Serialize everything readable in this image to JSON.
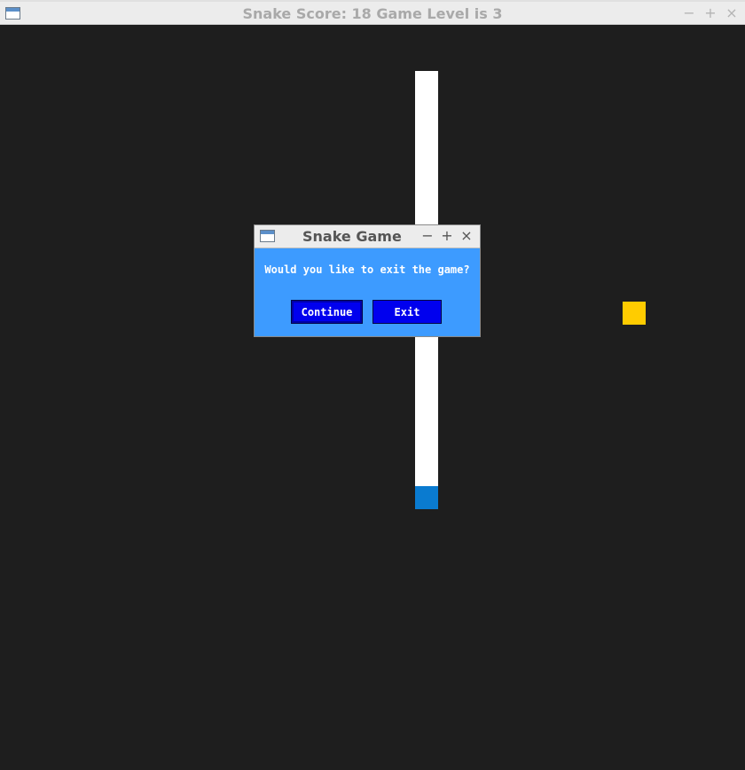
{
  "window": {
    "title": "Snake Score: 18  Game Level is 3",
    "controls": {
      "minimize": "−",
      "maximize": "+",
      "close": "×"
    }
  },
  "game": {
    "score": 18,
    "level": 3,
    "colors": {
      "background": "#1e1e1e",
      "body": "#ffffff",
      "head": "#0a7bd0",
      "food": "#ffcc00"
    }
  },
  "dialog": {
    "title": "Snake Game",
    "controls": {
      "minimize": "−",
      "maximize": "+",
      "close": "×"
    },
    "message": "Would you like to exit the game?",
    "continue_label": "Continue",
    "exit_label": "Exit",
    "colors": {
      "background": "#3d9bff",
      "button": "#0000ee"
    }
  }
}
